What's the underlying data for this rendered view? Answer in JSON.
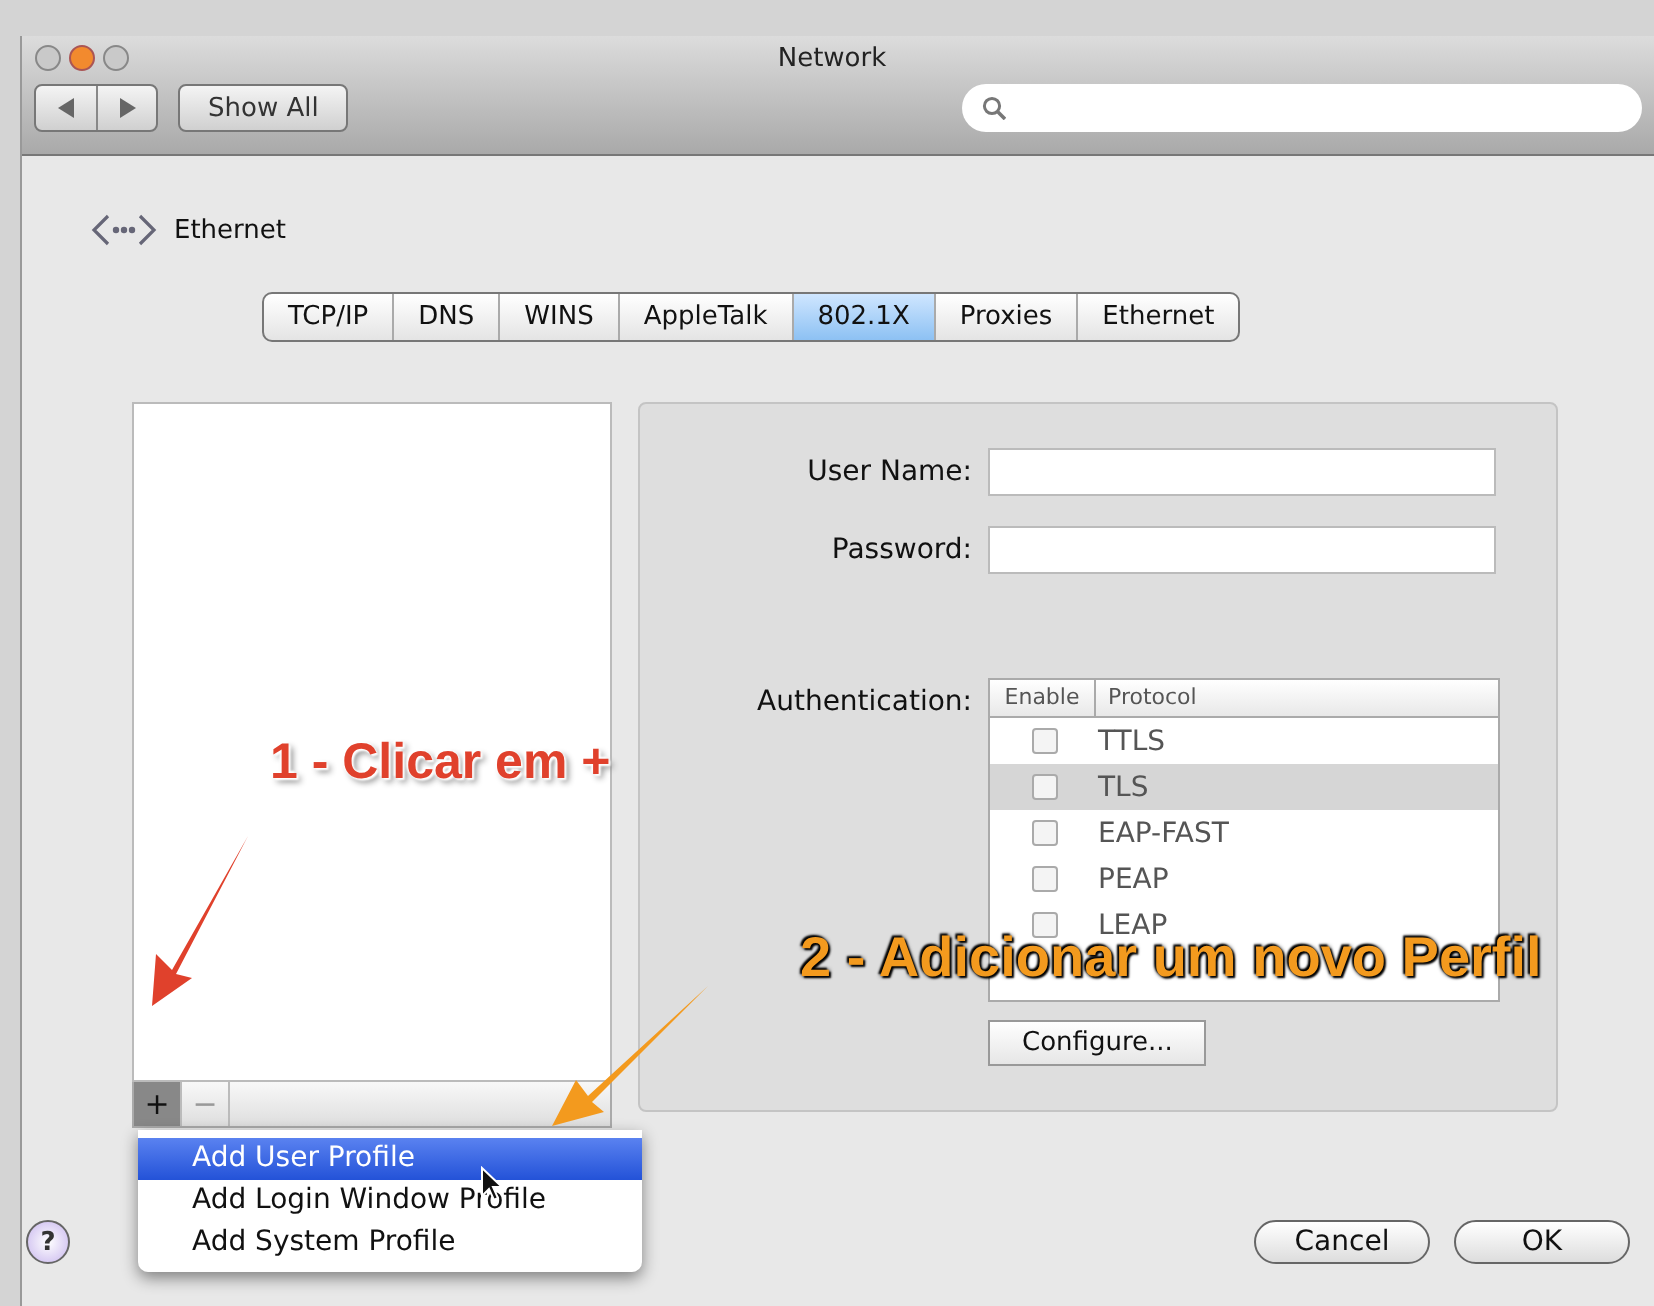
{
  "window": {
    "title": "Network"
  },
  "toolbar": {
    "show_all": "Show All"
  },
  "service": {
    "name": "Ethernet"
  },
  "tabs": [
    {
      "label": "TCP/IP",
      "selected": false
    },
    {
      "label": "DNS",
      "selected": false
    },
    {
      "label": "WINS",
      "selected": false
    },
    {
      "label": "AppleTalk",
      "selected": false
    },
    {
      "label": "802.1X",
      "selected": true
    },
    {
      "label": "Proxies",
      "selected": false
    },
    {
      "label": "Ethernet",
      "selected": false
    }
  ],
  "form": {
    "user_name": {
      "label": "User Name:"
    },
    "password": {
      "label": "Password:"
    },
    "authentication": {
      "label": "Authentication:",
      "columns": [
        "Enable",
        "Protocol"
      ],
      "rows": [
        {
          "protocol": "TTLS",
          "checked": false,
          "selected": false
        },
        {
          "protocol": "TLS",
          "checked": false,
          "selected": true
        },
        {
          "protocol": "EAP-FAST",
          "checked": false,
          "selected": false
        },
        {
          "protocol": "PEAP",
          "checked": false,
          "selected": false
        },
        {
          "protocol": "LEAP",
          "checked": false,
          "selected": false
        }
      ]
    },
    "configure": "Configure..."
  },
  "profile_list": {
    "add": "+",
    "remove": "−"
  },
  "menu": [
    {
      "label": "Add User Profile",
      "selected": true
    },
    {
      "label": "Add Login Window Profile",
      "selected": false
    },
    {
      "label": "Add System Profile",
      "selected": false
    }
  ],
  "buttons": {
    "help": "?",
    "cancel": "Cancel",
    "ok": "OK"
  },
  "annotations": [
    {
      "text": "1 - Clicar em +",
      "color": "#e0412c"
    },
    {
      "text": "2 - Adicionar um novo Perfil",
      "color": "#f39a1e"
    }
  ]
}
